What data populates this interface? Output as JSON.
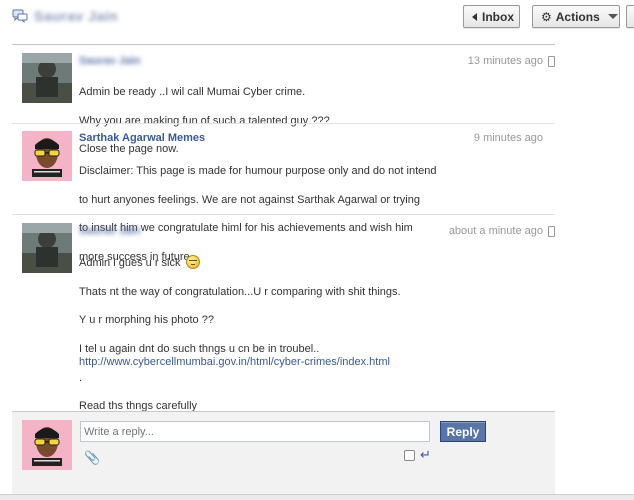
{
  "header": {
    "title": "Saurav Jain",
    "inbox_label": "Inbox",
    "actions_label": "Actions",
    "icon": "chat-bubbles-icon"
  },
  "messages": [
    {
      "sender": "Saurav Jain",
      "time": "13 minutes ago",
      "lines": [
        "Admin be ready ..I wil call Mumai Cyber crime.",
        "Why you are making fun of such a talented guy ???",
        "Close the page now."
      ],
      "mobile": true
    },
    {
      "sender": "Sarthak Agarwal Memes",
      "time": "9 minutes ago",
      "lines": [
        "Disclaimer: This page is made for humour purpose only and do not intend",
        "to hurt anyones feelings. We are not against Sarthak Agarwal or trying",
        "to insult him we congratulate himl for his achievements and wish him",
        "more success in future."
      ],
      "mobile": false
    },
    {
      "sender": "Saurav Jain",
      "time": "about a minute ago",
      "lines": [
        "Admin i gues u r sick",
        "Thats nt the way of congratulation...U r comparing with shit things.",
        "Y u r morphing his photo ??",
        "I tel u again dnt do such thngs u cn be in troubel..",
        ".",
        "Read ths thngs carefully"
      ],
      "link": "http://www.cybercellmumbai.gov.in/html/cyber-crimes/index.html",
      "mobile": true
    }
  ],
  "reply": {
    "placeholder": "Write a reply...",
    "button_label": "Reply"
  },
  "colors": {
    "link": "#3b5998",
    "reply_button": "#5b74a8"
  }
}
